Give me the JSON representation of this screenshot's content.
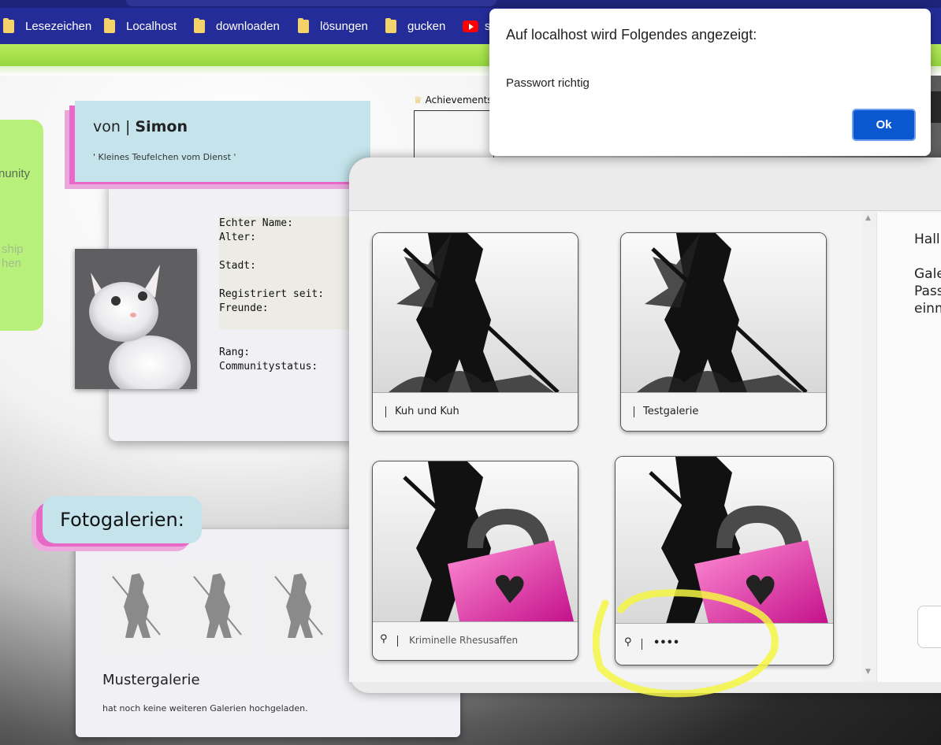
{
  "bookmarks": [
    {
      "label": "Lesezeichen",
      "type": "folder"
    },
    {
      "label": "Localhost",
      "type": "folder"
    },
    {
      "label": "downloaden",
      "type": "folder"
    },
    {
      "label": "lösungen",
      "type": "folder"
    },
    {
      "label": "gucken",
      "type": "folder"
    },
    {
      "label": "s",
      "type": "youtube"
    }
  ],
  "left_panel": {
    "lines": [
      "nunity",
      "ship",
      "hen"
    ]
  },
  "profile": {
    "von_prefix": "von |",
    "name": "Simon",
    "motto": "' Kleines Teufelchen vom Dienst '",
    "fields": [
      "Echter Name:",
      "Alter:",
      "Stadt:",
      "Registriert seit:",
      "Freunde:",
      "Rang:",
      "Communitystatus:"
    ]
  },
  "achievements": {
    "label": "Achievements"
  },
  "fotogalerien": {
    "title": "Fotogalerien:",
    "gallery_name": "Mustergalerie",
    "note": "hat noch keine weiteren Galerien hochgeladen."
  },
  "modal": {
    "galleries": [
      {
        "name": "Kuh und Kuh",
        "locked": false
      },
      {
        "name": "Testgalerie",
        "locked": false
      },
      {
        "name": "Kriminelle Rhesusaffen",
        "locked": true
      },
      {
        "name": "••••",
        "locked": true
      }
    ],
    "right_text": [
      "Hall",
      "Gale",
      "Pass",
      "einm"
    ]
  },
  "alert": {
    "title": "Auf localhost wird Folgendes angezeigt:",
    "message": "Passwort richtig",
    "ok_label": "Ok"
  },
  "colors": {
    "bookmark_bar": "#242c9a",
    "green_strip": "#a6e04a",
    "header_card": "#c4e3eb",
    "pink_accent": "#e868c6",
    "ok_button": "#0b57d0",
    "annotation": "#f5f542"
  }
}
